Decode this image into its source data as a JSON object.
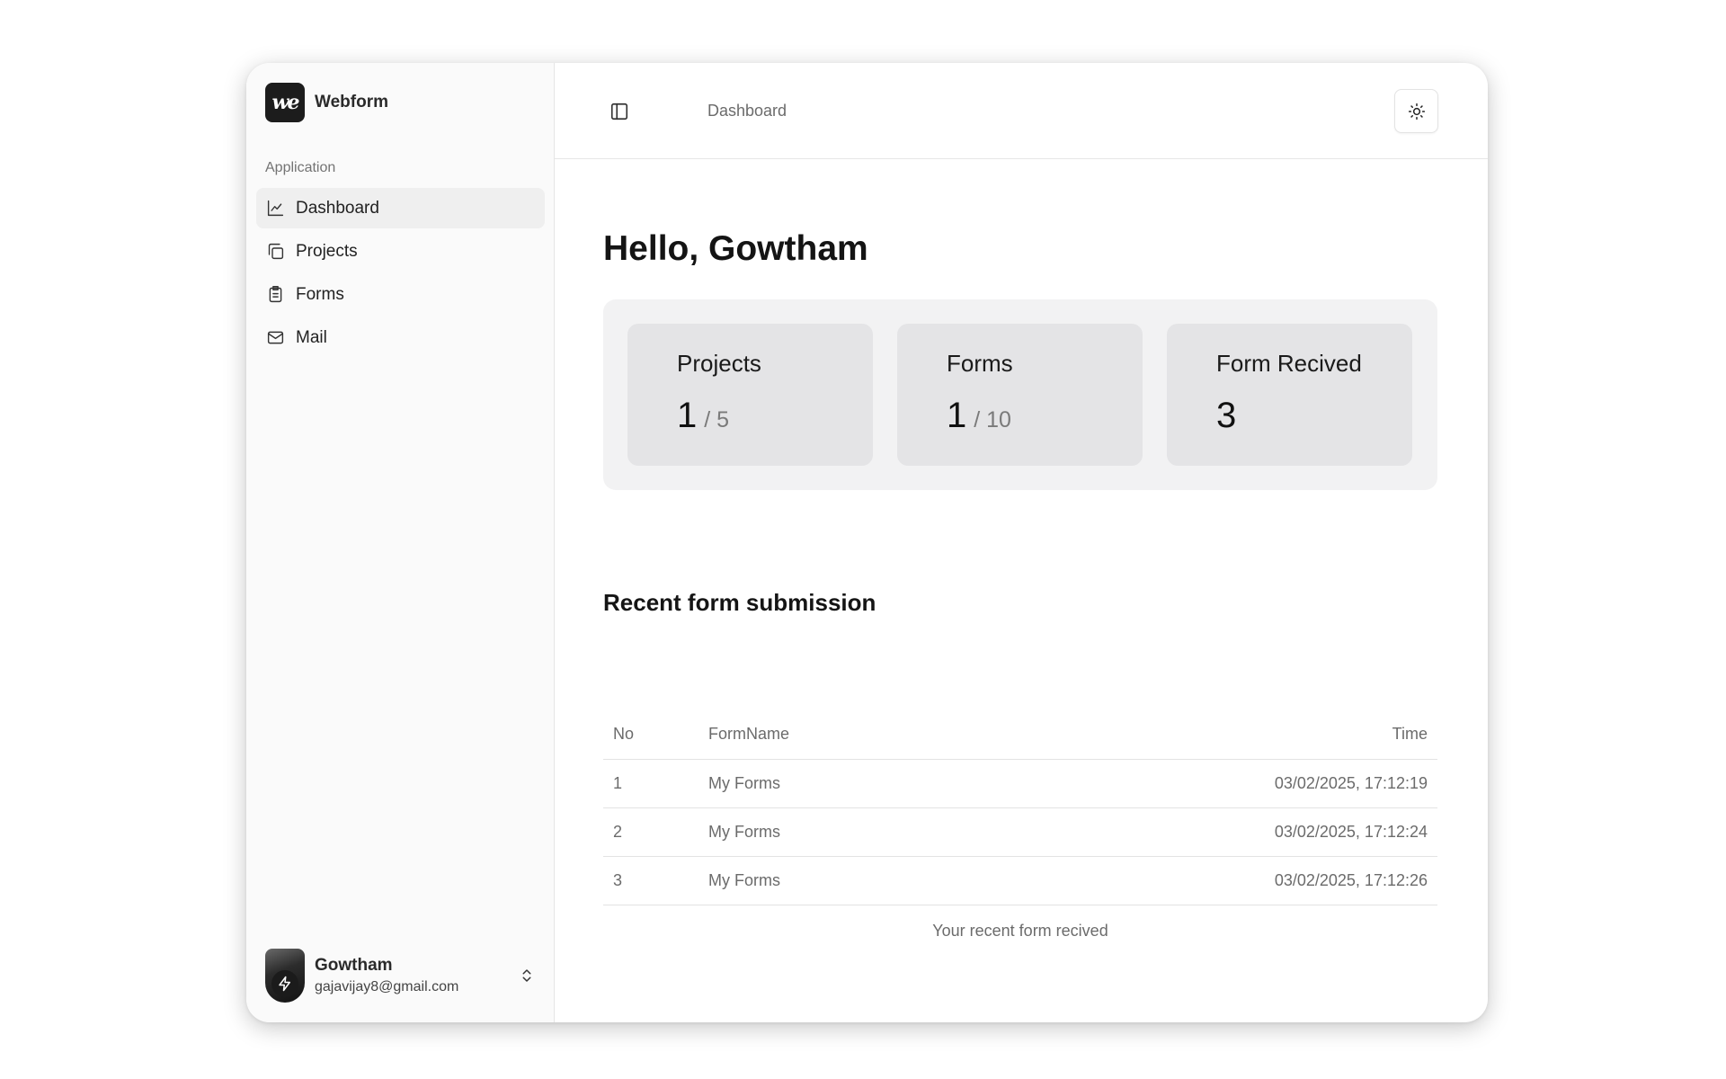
{
  "brand": {
    "name": "Webform",
    "logo_text": "we"
  },
  "sidebar": {
    "group_label": "Application",
    "items": [
      {
        "label": "Dashboard",
        "icon": "chart-line-icon",
        "active": true
      },
      {
        "label": "Projects",
        "icon": "copy-icon",
        "active": false
      },
      {
        "label": "Forms",
        "icon": "clipboard-list-icon",
        "active": false
      },
      {
        "label": "Mail",
        "icon": "mail-icon",
        "active": false
      }
    ]
  },
  "user": {
    "name": "Gowtham",
    "email": "gajavijay8@gmail.com"
  },
  "topbar": {
    "breadcrumb": "Dashboard",
    "toggle_icon": "panel-left-icon",
    "theme_icon": "sun-icon"
  },
  "main": {
    "greeting": "Hello, Gowtham",
    "stats": [
      {
        "title": "Projects",
        "value": "1",
        "total": "/ 5"
      },
      {
        "title": "Forms",
        "value": "1",
        "total": "/ 10"
      },
      {
        "title": "Form Recived",
        "value": "3",
        "total": ""
      }
    ],
    "recent": {
      "title": "Recent form submission",
      "columns": [
        "No",
        "FormName",
        "Time"
      ],
      "rows": [
        {
          "no": "1",
          "name": "My Forms",
          "time": "03/02/2025, 17:12:19"
        },
        {
          "no": "2",
          "name": "My Forms",
          "time": "03/02/2025, 17:12:24"
        },
        {
          "no": "3",
          "name": "My Forms",
          "time": "03/02/2025, 17:12:26"
        }
      ],
      "caption": "Your recent form recived"
    }
  },
  "colors": {
    "sidebar_bg": "#fafafa",
    "card_bg": "#e4e4e6",
    "stats_bg": "#f2f2f3",
    "logo_bg": "#1c1c1c"
  }
}
